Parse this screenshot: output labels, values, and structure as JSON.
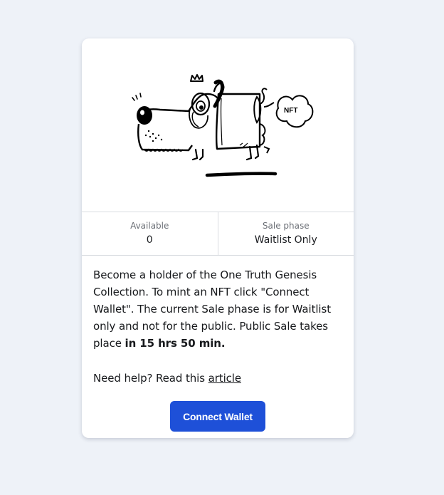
{
  "card": {
    "image": {
      "alt_icon": "dog-nft-illustration",
      "bubble_text": "NFT"
    },
    "stats": [
      {
        "label": "Available",
        "value": "0"
      },
      {
        "label": "Sale phase",
        "value": "Waitlist Only"
      }
    ],
    "description": {
      "text": "Become a holder of the One Truth Genesis Collection. To mint an NFT click \"Connect Wallet\". The current Sale phase is for Waitlist only and not for the public. Public Sale takes place ",
      "countdown": "in 15 hrs 50 min."
    },
    "help": {
      "prefix": "Need help? Read this ",
      "link_text": "article"
    },
    "button_label": "Connect Wallet"
  },
  "colors": {
    "background": "#eef2f8",
    "button": "#1e50d8",
    "divider": "#d9dce1"
  }
}
